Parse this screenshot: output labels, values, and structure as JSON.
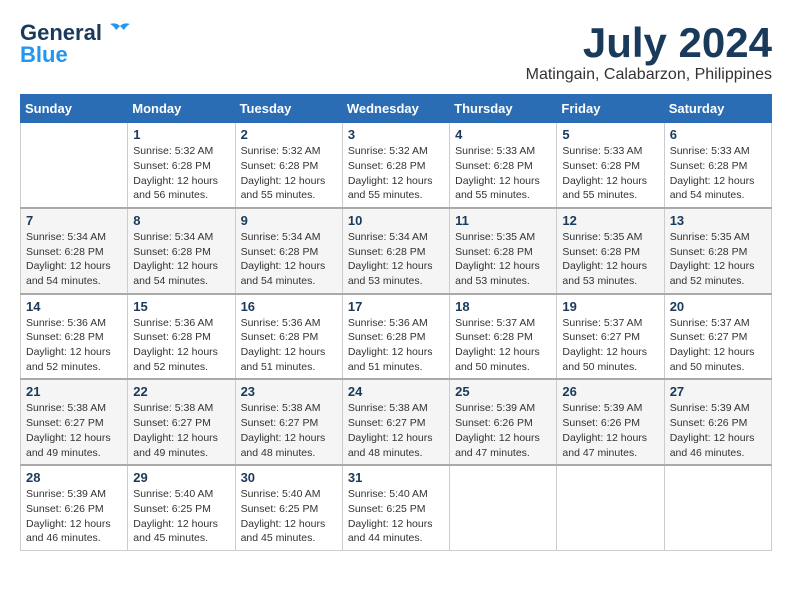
{
  "header": {
    "logo_line1": "General",
    "logo_line2": "Blue",
    "main_title": "July 2024",
    "subtitle": "Matingain, Calabarzon, Philippines"
  },
  "calendar": {
    "days_of_week": [
      "Sunday",
      "Monday",
      "Tuesday",
      "Wednesday",
      "Thursday",
      "Friday",
      "Saturday"
    ],
    "weeks": [
      [
        {
          "day": "",
          "info": ""
        },
        {
          "day": "1",
          "info": "Sunrise: 5:32 AM\nSunset: 6:28 PM\nDaylight: 12 hours\nand 56 minutes."
        },
        {
          "day": "2",
          "info": "Sunrise: 5:32 AM\nSunset: 6:28 PM\nDaylight: 12 hours\nand 55 minutes."
        },
        {
          "day": "3",
          "info": "Sunrise: 5:32 AM\nSunset: 6:28 PM\nDaylight: 12 hours\nand 55 minutes."
        },
        {
          "day": "4",
          "info": "Sunrise: 5:33 AM\nSunset: 6:28 PM\nDaylight: 12 hours\nand 55 minutes."
        },
        {
          "day": "5",
          "info": "Sunrise: 5:33 AM\nSunset: 6:28 PM\nDaylight: 12 hours\nand 55 minutes."
        },
        {
          "day": "6",
          "info": "Sunrise: 5:33 AM\nSunset: 6:28 PM\nDaylight: 12 hours\nand 54 minutes."
        }
      ],
      [
        {
          "day": "7",
          "info": "Sunrise: 5:34 AM\nSunset: 6:28 PM\nDaylight: 12 hours\nand 54 minutes."
        },
        {
          "day": "8",
          "info": "Sunrise: 5:34 AM\nSunset: 6:28 PM\nDaylight: 12 hours\nand 54 minutes."
        },
        {
          "day": "9",
          "info": "Sunrise: 5:34 AM\nSunset: 6:28 PM\nDaylight: 12 hours\nand 54 minutes."
        },
        {
          "day": "10",
          "info": "Sunrise: 5:34 AM\nSunset: 6:28 PM\nDaylight: 12 hours\nand 53 minutes."
        },
        {
          "day": "11",
          "info": "Sunrise: 5:35 AM\nSunset: 6:28 PM\nDaylight: 12 hours\nand 53 minutes."
        },
        {
          "day": "12",
          "info": "Sunrise: 5:35 AM\nSunset: 6:28 PM\nDaylight: 12 hours\nand 53 minutes."
        },
        {
          "day": "13",
          "info": "Sunrise: 5:35 AM\nSunset: 6:28 PM\nDaylight: 12 hours\nand 52 minutes."
        }
      ],
      [
        {
          "day": "14",
          "info": "Sunrise: 5:36 AM\nSunset: 6:28 PM\nDaylight: 12 hours\nand 52 minutes."
        },
        {
          "day": "15",
          "info": "Sunrise: 5:36 AM\nSunset: 6:28 PM\nDaylight: 12 hours\nand 52 minutes."
        },
        {
          "day": "16",
          "info": "Sunrise: 5:36 AM\nSunset: 6:28 PM\nDaylight: 12 hours\nand 51 minutes."
        },
        {
          "day": "17",
          "info": "Sunrise: 5:36 AM\nSunset: 6:28 PM\nDaylight: 12 hours\nand 51 minutes."
        },
        {
          "day": "18",
          "info": "Sunrise: 5:37 AM\nSunset: 6:28 PM\nDaylight: 12 hours\nand 50 minutes."
        },
        {
          "day": "19",
          "info": "Sunrise: 5:37 AM\nSunset: 6:27 PM\nDaylight: 12 hours\nand 50 minutes."
        },
        {
          "day": "20",
          "info": "Sunrise: 5:37 AM\nSunset: 6:27 PM\nDaylight: 12 hours\nand 50 minutes."
        }
      ],
      [
        {
          "day": "21",
          "info": "Sunrise: 5:38 AM\nSunset: 6:27 PM\nDaylight: 12 hours\nand 49 minutes."
        },
        {
          "day": "22",
          "info": "Sunrise: 5:38 AM\nSunset: 6:27 PM\nDaylight: 12 hours\nand 49 minutes."
        },
        {
          "day": "23",
          "info": "Sunrise: 5:38 AM\nSunset: 6:27 PM\nDaylight: 12 hours\nand 48 minutes."
        },
        {
          "day": "24",
          "info": "Sunrise: 5:38 AM\nSunset: 6:27 PM\nDaylight: 12 hours\nand 48 minutes."
        },
        {
          "day": "25",
          "info": "Sunrise: 5:39 AM\nSunset: 6:26 PM\nDaylight: 12 hours\nand 47 minutes."
        },
        {
          "day": "26",
          "info": "Sunrise: 5:39 AM\nSunset: 6:26 PM\nDaylight: 12 hours\nand 47 minutes."
        },
        {
          "day": "27",
          "info": "Sunrise: 5:39 AM\nSunset: 6:26 PM\nDaylight: 12 hours\nand 46 minutes."
        }
      ],
      [
        {
          "day": "28",
          "info": "Sunrise: 5:39 AM\nSunset: 6:26 PM\nDaylight: 12 hours\nand 46 minutes."
        },
        {
          "day": "29",
          "info": "Sunrise: 5:40 AM\nSunset: 6:25 PM\nDaylight: 12 hours\nand 45 minutes."
        },
        {
          "day": "30",
          "info": "Sunrise: 5:40 AM\nSunset: 6:25 PM\nDaylight: 12 hours\nand 45 minutes."
        },
        {
          "day": "31",
          "info": "Sunrise: 5:40 AM\nSunset: 6:25 PM\nDaylight: 12 hours\nand 44 minutes."
        },
        {
          "day": "",
          "info": ""
        },
        {
          "day": "",
          "info": ""
        },
        {
          "day": "",
          "info": ""
        }
      ]
    ]
  }
}
